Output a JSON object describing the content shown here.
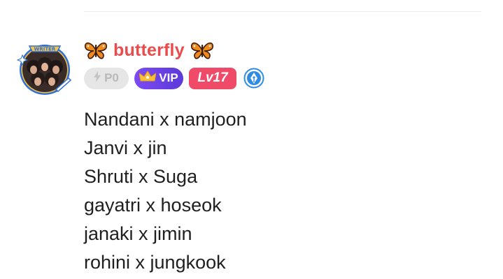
{
  "post": {
    "author": {
      "username": "butterfly",
      "avatar_label": "WRITER",
      "emoji_left": "butterfly-emoji",
      "emoji_right": "butterfly-emoji"
    },
    "badges": {
      "points": "P0",
      "vip": "VIP",
      "level": "Lv17",
      "writer_badge_icon": "pen-nib-icon"
    },
    "lines": [
      "Nandani x namjoon",
      "Janvi x jin",
      "Shruti x Suga",
      "gayatri x hoseok",
      "janaki x jimin",
      "rohini x jungkook"
    ]
  },
  "colors": {
    "username": "#e94c4c",
    "vip_gradient_start": "#7d4af3",
    "vip_gradient_end": "#5c3ad9",
    "level_bg": "#ef4a68",
    "points_bg": "#e6e6e6",
    "text": "#1f1f1f"
  }
}
